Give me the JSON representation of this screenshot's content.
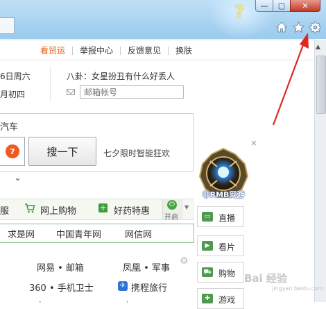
{
  "window": {
    "help_glyph": "?",
    "min_glyph": "—",
    "max_glyph": "▢",
    "close_glyph": "✕",
    "toolbar_icons": [
      "home-icon",
      "star-icon",
      "gear-icon"
    ]
  },
  "topnav": {
    "items": [
      "看贸运",
      "举报中心",
      "反馈意见",
      "换肤"
    ],
    "accent": "#e4641c"
  },
  "info": {
    "date_line1": "6日周六",
    "date_line2": "月初四",
    "gossip": "八卦：女星扮丑有什么好丢人",
    "mail_placeholder": "邮箱帐号"
  },
  "search": {
    "category": "汽车",
    "badge": "7",
    "button_label": "搜一下",
    "hint": "七夕限时智能狂欢",
    "more": "⌄"
  },
  "ad": {
    "close": "×",
    "label": "非RMB网游"
  },
  "shopping": {
    "partial_label": "服",
    "cart_label": "网上购物",
    "drug_label": "好药特惠",
    "toggle_label": "开启",
    "dropdown": "▼"
  },
  "sites": [
    "求是网",
    "中国青年网",
    "网信网"
  ],
  "side_tabs": [
    "直播",
    "看片",
    "购物",
    "游戏"
  ],
  "grid": {
    "row1_left": "网易 • 邮箱",
    "row1_right": "凤凰 • 军事",
    "row2_left": "360 • 手机卫士",
    "row2_right": "携程旅行",
    "row3": "•"
  },
  "watermark": {
    "main": "Bai 经验",
    "sub": "jingyan.baidu.com"
  },
  "colors": {
    "chrome": "#a8d2f0",
    "arrow": "#e0281e",
    "green": "#3b9d3b"
  }
}
